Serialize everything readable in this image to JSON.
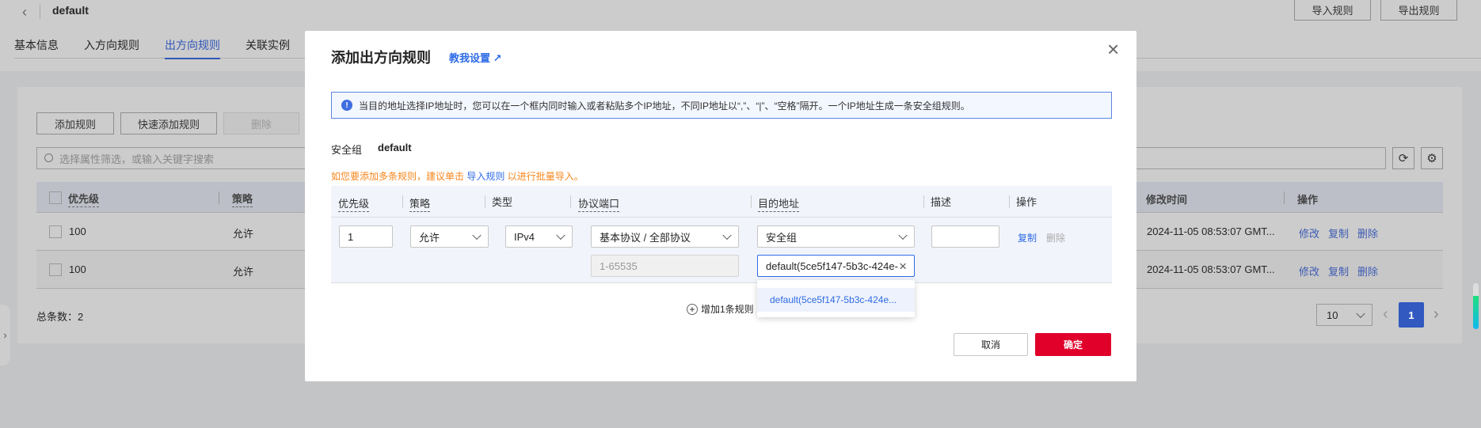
{
  "header": {
    "title": "default",
    "import_button": "导入规则",
    "export_button": "导出规则"
  },
  "tabs": [
    {
      "label": "基本信息"
    },
    {
      "label": "入方向规则"
    },
    {
      "label": "出方向规则",
      "active": true
    },
    {
      "label": "关联实例"
    }
  ],
  "toolbar": {
    "add": "添加规则",
    "quick_add": "快速添加规则",
    "delete": "删除",
    "search_placeholder": "选择属性筛选，或输入关键字搜索"
  },
  "table": {
    "columns": [
      "优先级",
      "策略",
      "修改时间",
      "操作"
    ],
    "rows": [
      {
        "priority": "100",
        "policy": "允许",
        "modified": "2024-11-05 08:53:07 GMT...",
        "actions": [
          "修改",
          "复制",
          "删除"
        ]
      },
      {
        "priority": "100",
        "policy": "允许",
        "modified": "2024-11-05 08:53:07 GMT...",
        "actions": [
          "修改",
          "复制",
          "删除"
        ]
      }
    ]
  },
  "pagination": {
    "total": "总条数：2",
    "page_size": "10",
    "current_page": "1"
  },
  "modal": {
    "title": "添加出方向规则",
    "help_link": "教我设置",
    "info": "当目的地址选择IP地址时，您可以在一个框内同时输入或者粘贴多个IP地址，不同IP地址以“,”、“|”、“空格”隔开。一个IP地址生成一条安全组规则。",
    "sg_label": "安全组",
    "sg_value": "default",
    "tip_prefix": "如您要添加多条规则，建议单击 ",
    "tip_link": "导入规则",
    "tip_suffix": " 以进行批量导入。",
    "columns": [
      "优先级",
      "策略",
      "类型",
      "协议端口",
      "目的地址",
      "描述",
      "操作"
    ],
    "rule": {
      "priority": "1",
      "policy": "允许",
      "type": "IPv4",
      "protocol": "基本协议 / 全部协议",
      "port": "1-65535",
      "dest_type": "安全组",
      "dest_value": "default(5ce5f147-5b3c-424e-",
      "desc": "",
      "copy": "复制",
      "delete": "删除"
    },
    "dropdown_option": "default(5ce5f147-5b3c-424e...",
    "add_rule": "增加1条规则",
    "cancel": "取消",
    "confirm": "确定"
  },
  "colors": {
    "accent": "#2e6be6",
    "confirm": "#e0002a",
    "warning": "#f7861c"
  }
}
